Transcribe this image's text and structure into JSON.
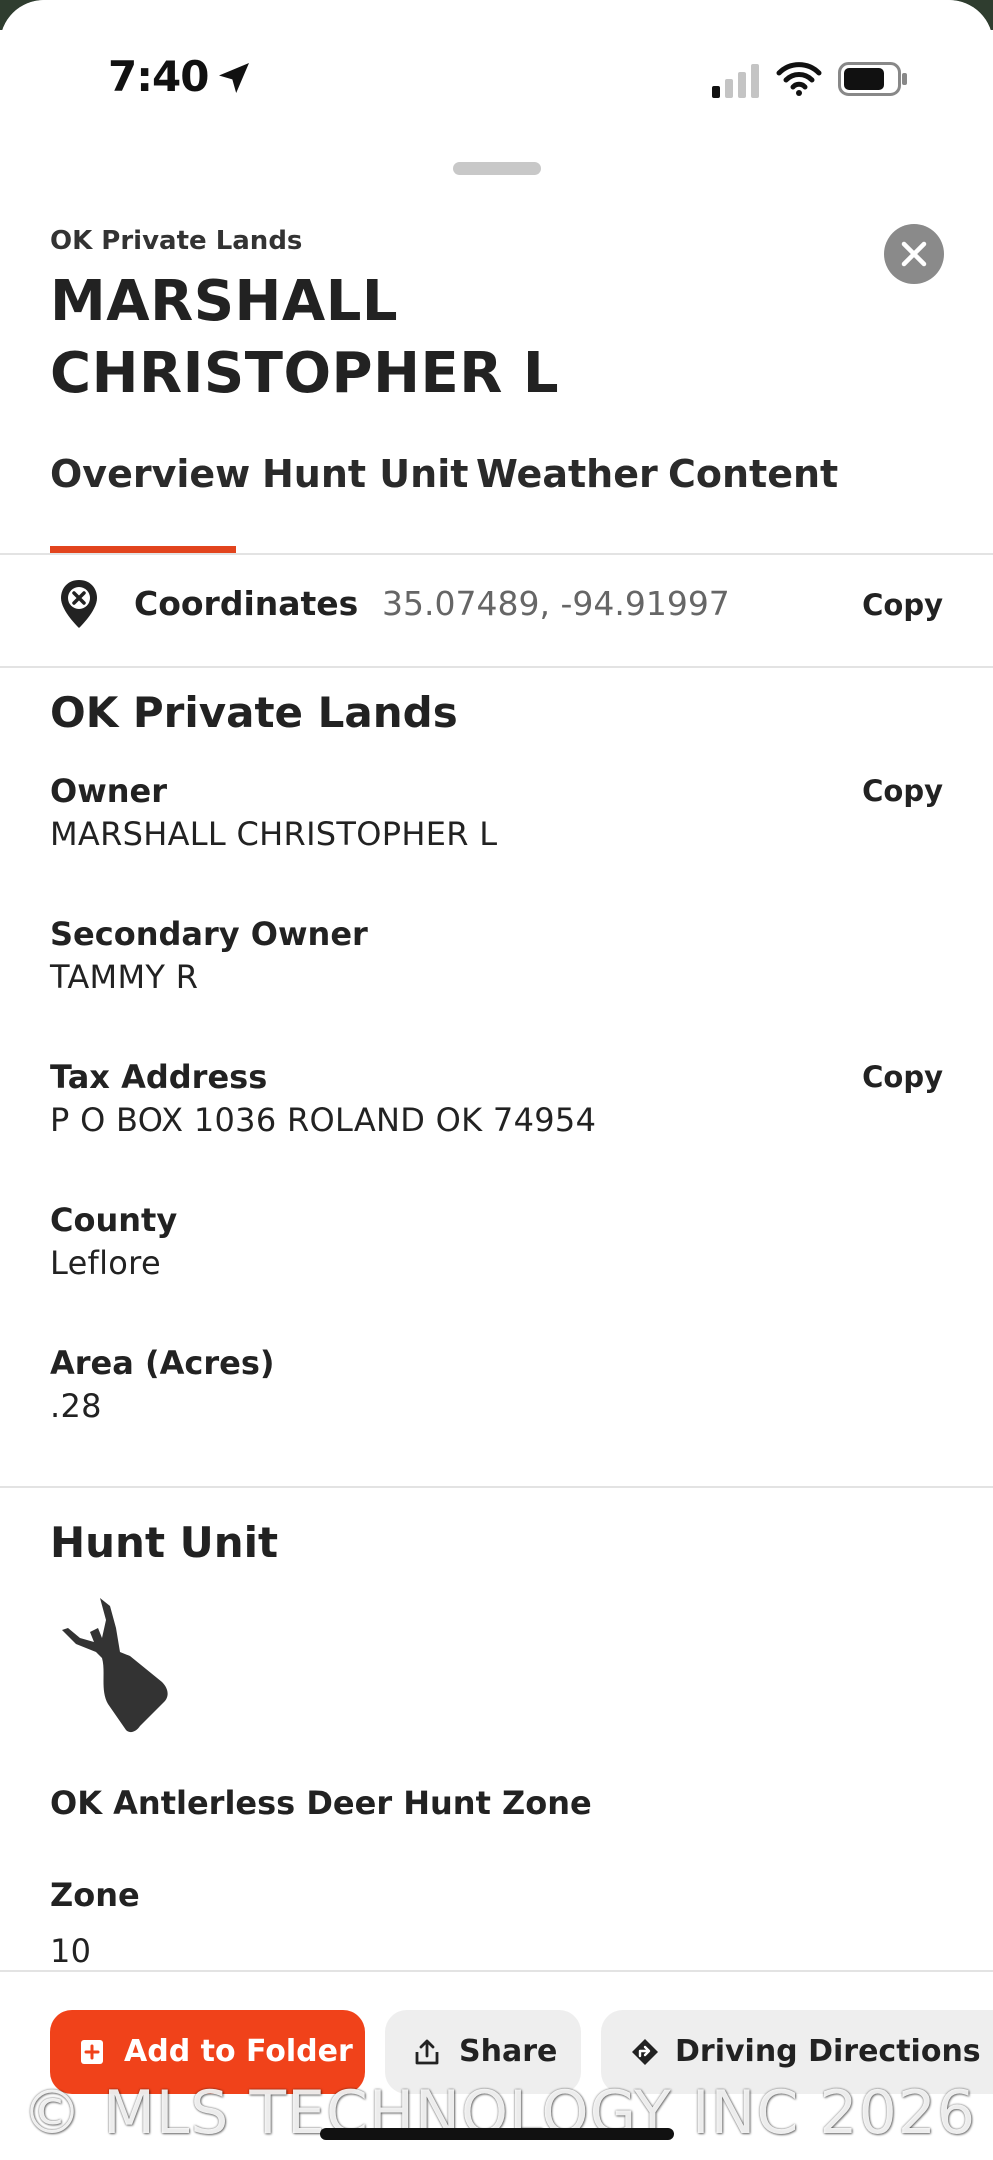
{
  "status_bar": {
    "time": "7:40",
    "icons": [
      "location-arrow-icon",
      "cellular-signal-icon",
      "wifi-icon",
      "battery-icon"
    ]
  },
  "header": {
    "subtitle": "OK Private Lands",
    "title": "MARSHALL CHRISTOPHER L",
    "close_icon": "close-icon"
  },
  "tabs": [
    {
      "label": "Overview",
      "active": true
    },
    {
      "label": "Hunt Unit",
      "active": false
    },
    {
      "label": "Weather",
      "active": false
    },
    {
      "label": "Content",
      "active": false
    }
  ],
  "coordinates": {
    "label": "Coordinates",
    "value": "35.07489, -94.91997",
    "copy_label": "Copy"
  },
  "private_lands": {
    "section_title": "OK Private Lands",
    "fields": [
      {
        "label": "Owner",
        "value": "MARSHALL CHRISTOPHER L",
        "copy_label": "Copy"
      },
      {
        "label": "Secondary Owner",
        "value": "TAMMY R"
      },
      {
        "label": "Tax Address",
        "value": "P O BOX 1036 ROLAND OK 74954",
        "copy_label": "Copy"
      },
      {
        "label": "County",
        "value": "Leflore"
      },
      {
        "label": "Area (Acres)",
        "value": ".28"
      }
    ]
  },
  "hunt_unit": {
    "section_title": "Hunt Unit",
    "icon": "deer-head-icon",
    "zone_name": "OK Antlerless Deer Hunt Zone",
    "zone_label": "Zone",
    "zone_value": "10"
  },
  "actions": {
    "add_to_folder": "Add to Folder",
    "share": "Share",
    "driving_directions": "Driving Directions"
  },
  "watermark": "© MLS TECHNOLOGY INC 2026",
  "colors": {
    "accent": "#f0421a",
    "tab_underline": "#e2441d",
    "secondary_button": "#eeeeee",
    "close_button": "#8a8a8a"
  }
}
